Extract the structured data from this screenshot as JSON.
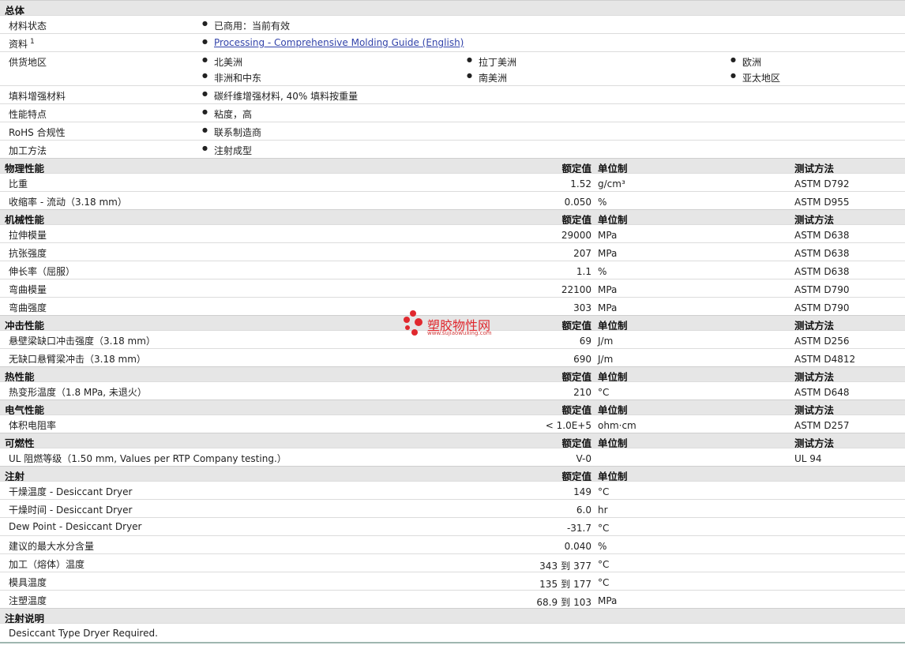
{
  "general": {
    "title": "总体",
    "status_label": "材料状态",
    "status_value": "已商用：当前有效",
    "docs_label": "资料",
    "docs_sup": "1",
    "docs_link": "Processing - Comprehensive Molding Guide (English)",
    "regions_label": "供货地区",
    "regions": [
      "北美洲",
      "拉丁美洲",
      "欧洲",
      "非洲和中东",
      "南美洲",
      "亚太地区"
    ],
    "filler_label": "填料增强材料",
    "filler_value": "碳纤维增强材料, 40% 填料按重量",
    "features_label": "性能特点",
    "features_value": "粘度，高",
    "rohs_label": "RoHS 合规性",
    "rohs_value": "联系制造商",
    "process_label": "加工方法",
    "process_value": "注射成型"
  },
  "headers": {
    "value": "额定值",
    "unit": "单位制",
    "method": "测试方法"
  },
  "sections": [
    {
      "title": "物理性能",
      "show_method": true,
      "rows": [
        {
          "label": "比重",
          "value": "1.52",
          "unit": "g/cm³",
          "method": "ASTM D792"
        },
        {
          "label": "收缩率  - 流动（3.18 mm）",
          "value": "0.050",
          "unit": "%",
          "method": "ASTM D955"
        }
      ]
    },
    {
      "title": "机械性能",
      "show_method": true,
      "rows": [
        {
          "label": "拉伸模量",
          "value": "29000",
          "unit": "MPa",
          "method": "ASTM D638"
        },
        {
          "label": "抗张强度",
          "value": "207",
          "unit": "MPa",
          "method": "ASTM D638"
        },
        {
          "label": "伸长率（屈服）",
          "value": "1.1",
          "unit": "%",
          "method": "ASTM D638"
        },
        {
          "label": "弯曲模量",
          "value": "22100",
          "unit": "MPa",
          "method": "ASTM D790"
        },
        {
          "label": "弯曲强度",
          "value": "303",
          "unit": "MPa",
          "method": "ASTM D790"
        }
      ]
    },
    {
      "title": "冲击性能",
      "show_method": true,
      "rows": [
        {
          "label": "悬壁梁缺口冲击强度（3.18 mm）",
          "value": "69",
          "unit": "J/m",
          "method": "ASTM D256"
        },
        {
          "label": "无缺口悬臂梁冲击（3.18 mm）",
          "value": "690",
          "unit": "J/m",
          "method": "ASTM D4812"
        }
      ]
    },
    {
      "title": "热性能",
      "show_method": true,
      "rows": [
        {
          "label": "热变形温度（1.8 MPa, 未退火）",
          "value": "210",
          "unit": "°C",
          "method": "ASTM D648"
        }
      ]
    },
    {
      "title": "电气性能",
      "show_method": true,
      "rows": [
        {
          "label": "体积电阻率",
          "value": "< 1.0E+5",
          "unit": "ohm·cm",
          "method": "ASTM D257"
        }
      ]
    },
    {
      "title": "可燃性",
      "show_method": true,
      "rows": [
        {
          "label": "UL 阻燃等级（1.50 mm, Values per RTP Company testing.）",
          "value": "V-0",
          "unit": "",
          "method": "UL 94"
        }
      ]
    },
    {
      "title": "注射",
      "show_method": false,
      "rows": [
        {
          "label": "干燥温度  - Desiccant Dryer",
          "value": "149",
          "unit": "°C",
          "method": ""
        },
        {
          "label": "干燥时间  - Desiccant Dryer",
          "value": "6.0",
          "unit": "hr",
          "method": ""
        },
        {
          "label": "Dew Point - Desiccant Dryer",
          "value": "-31.7",
          "unit": "°C",
          "method": ""
        },
        {
          "label": "建议的最大水分含量",
          "value": "0.040",
          "unit": "%",
          "method": ""
        },
        {
          "label": "加工（熔体）温度",
          "value": "343",
          "value2": "377",
          "sep": "到",
          "unit": "°C",
          "method": ""
        },
        {
          "label": "模具温度",
          "value": "135",
          "value2": "177",
          "sep": "到",
          "unit": "°C",
          "method": ""
        },
        {
          "label": "注塑温度",
          "value": "68.9",
          "value2": "103",
          "sep": "到",
          "unit": "MPa",
          "method": ""
        }
      ]
    }
  ],
  "notes": {
    "title": "注射说明",
    "text": "Desiccant Type Dryer Required."
  },
  "watermark": {
    "name": "塑胶物性网",
    "url": "www.sujiaowuxing.com",
    "color": "#e0282e"
  }
}
